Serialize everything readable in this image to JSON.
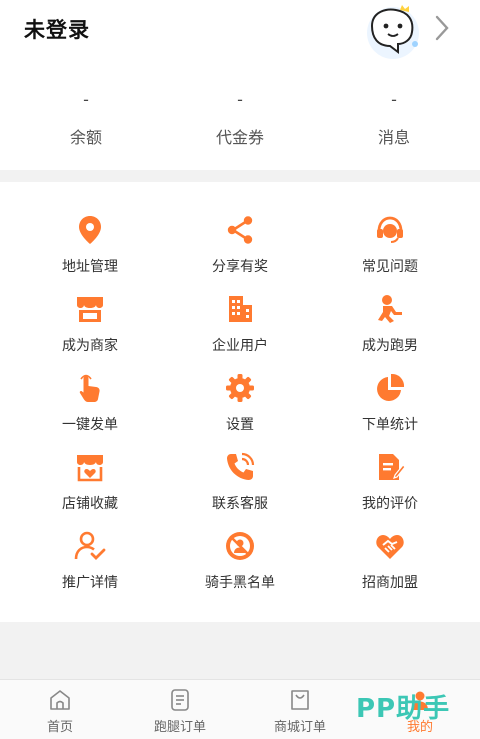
{
  "header": {
    "title": "未登录",
    "stats": [
      {
        "value": "-",
        "label": "余额"
      },
      {
        "value": "-",
        "label": "代金券"
      },
      {
        "value": "-",
        "label": "消息"
      }
    ]
  },
  "menu": {
    "accent_color": "#ff7a30",
    "items": [
      {
        "label": "地址管理",
        "icon": "location-pin-icon"
      },
      {
        "label": "分享有奖",
        "icon": "share-icon"
      },
      {
        "label": "常见问题",
        "icon": "headset-support-icon"
      },
      {
        "label": "成为商家",
        "icon": "storefront-icon"
      },
      {
        "label": "企业用户",
        "icon": "building-icon"
      },
      {
        "label": "成为跑男",
        "icon": "runner-icon"
      },
      {
        "label": "一键发单",
        "icon": "tap-hand-icon"
      },
      {
        "label": "设置",
        "icon": "gear-icon"
      },
      {
        "label": "下单统计",
        "icon": "pie-chart-icon"
      },
      {
        "label": "店铺收藏",
        "icon": "store-heart-icon"
      },
      {
        "label": "联系客服",
        "icon": "phone-call-icon"
      },
      {
        "label": "我的评价",
        "icon": "edit-document-icon"
      },
      {
        "label": "推广详情",
        "icon": "user-check-icon"
      },
      {
        "label": "骑手黑名单",
        "icon": "blocked-user-icon"
      },
      {
        "label": "招商加盟",
        "icon": "handshake-heart-icon"
      }
    ]
  },
  "tabbar": {
    "tabs": [
      {
        "label": "首页",
        "icon": "home-icon"
      },
      {
        "label": "跑腿订单",
        "icon": "order-list-icon"
      },
      {
        "label": "商城订单",
        "icon": "shopping-bag-icon"
      },
      {
        "label": "我的",
        "icon": "profile-icon",
        "active": true
      }
    ]
  },
  "watermark": {
    "text": "PP助手"
  }
}
